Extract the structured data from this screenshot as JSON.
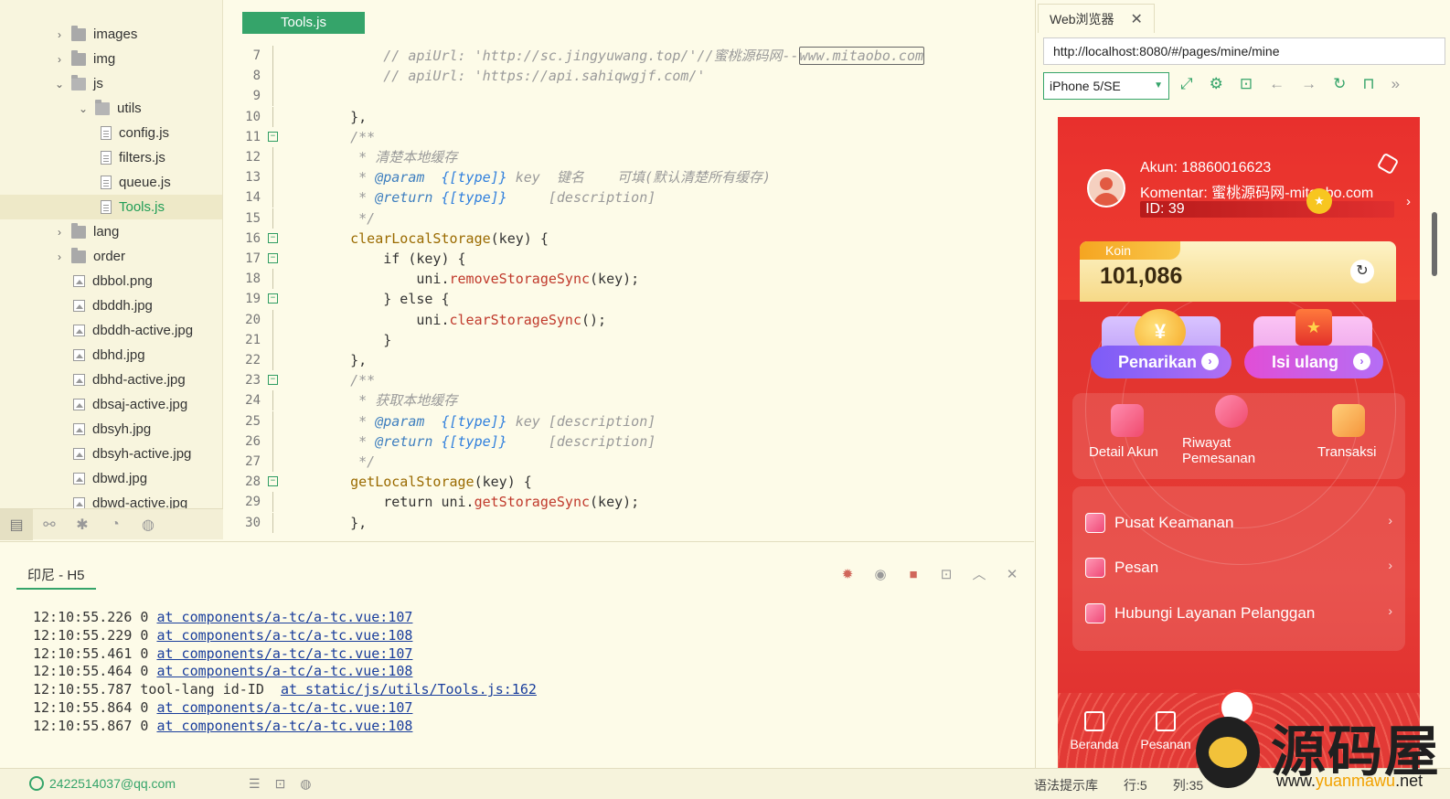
{
  "file_tree": {
    "items": [
      {
        "label": "images",
        "type": "folder",
        "indent": 1,
        "expanded": false
      },
      {
        "label": "img",
        "type": "folder",
        "indent": 1,
        "expanded": false
      },
      {
        "label": "js",
        "type": "folder",
        "indent": 1,
        "expanded": true
      },
      {
        "label": "utils",
        "type": "folder",
        "indent": 2,
        "expanded": true
      },
      {
        "label": "config.js",
        "type": "js",
        "indent": 3
      },
      {
        "label": "filters.js",
        "type": "js",
        "indent": 3
      },
      {
        "label": "queue.js",
        "type": "js",
        "indent": 3
      },
      {
        "label": "Tools.js",
        "type": "js",
        "indent": 3,
        "selected": true
      },
      {
        "label": "lang",
        "type": "folder",
        "indent": 1,
        "expanded": false
      },
      {
        "label": "order",
        "type": "folder",
        "indent": 1,
        "expanded": false
      },
      {
        "label": "dbbol.png",
        "type": "img",
        "indent": 1
      },
      {
        "label": "dbddh.jpg",
        "type": "img",
        "indent": 1
      },
      {
        "label": "dbddh-active.jpg",
        "type": "img",
        "indent": 1
      },
      {
        "label": "dbhd.jpg",
        "type": "img",
        "indent": 1
      },
      {
        "label": "dbhd-active.jpg",
        "type": "img",
        "indent": 1
      },
      {
        "label": "dbsaj-active.jpg",
        "type": "img",
        "indent": 1
      },
      {
        "label": "dbsyh.jpg",
        "type": "img",
        "indent": 1
      },
      {
        "label": "dbsyh-active.jpg",
        "type": "img",
        "indent": 1
      },
      {
        "label": "dbwd.jpg",
        "type": "img",
        "indent": 1
      },
      {
        "label": "dbwd-active.jpg",
        "type": "img",
        "indent": 1
      }
    ]
  },
  "editor": {
    "tab_label": "Tools.js",
    "lines": [
      {
        "n": "7",
        "fold": "",
        "segments": [
          {
            "t": "        "
          },
          {
            "t": "// apiUrl: 'http://sc.jingyuwang.top/'//蜜桃源码网--",
            "c": "tok-comment"
          },
          {
            "t": "www.mitaobo.com",
            "c": "tok-comment boxed"
          }
        ]
      },
      {
        "n": "8",
        "fold": "",
        "segments": [
          {
            "t": "        "
          },
          {
            "t": "// apiUrl: 'https://api.sahiqwgjf.com/'",
            "c": "tok-comment"
          }
        ]
      },
      {
        "n": "9",
        "fold": "",
        "segments": [
          {
            "t": ""
          }
        ]
      },
      {
        "n": "10",
        "fold": "",
        "segments": [
          {
            "t": "    },"
          }
        ]
      },
      {
        "n": "11",
        "fold": "box",
        "segments": [
          {
            "t": "    "
          },
          {
            "t": "/**",
            "c": "tok-comment"
          }
        ]
      },
      {
        "n": "12",
        "fold": "",
        "segments": [
          {
            "t": "     "
          },
          {
            "t": "* 清楚本地缓存",
            "c": "tok-comment"
          }
        ]
      },
      {
        "n": "13",
        "fold": "",
        "segments": [
          {
            "t": "     "
          },
          {
            "t": "* ",
            "c": "tok-comment"
          },
          {
            "t": "@param",
            "c": "tok-tag"
          },
          {
            "t": "  ",
            "c": "tok-comment"
          },
          {
            "t": "{[type]}",
            "c": "tok-type"
          },
          {
            "t": " key  键名    可填(默认清楚所有缓存)",
            "c": "tok-comment"
          }
        ]
      },
      {
        "n": "14",
        "fold": "",
        "segments": [
          {
            "t": "     "
          },
          {
            "t": "* ",
            "c": "tok-comment"
          },
          {
            "t": "@return",
            "c": "tok-tag"
          },
          {
            "t": " ",
            "c": "tok-comment"
          },
          {
            "t": "{[type]}",
            "c": "tok-type"
          },
          {
            "t": "     [description]",
            "c": "tok-comment"
          }
        ]
      },
      {
        "n": "15",
        "fold": "",
        "segments": [
          {
            "t": "     "
          },
          {
            "t": "*/",
            "c": "tok-comment"
          }
        ]
      },
      {
        "n": "16",
        "fold": "box",
        "segments": [
          {
            "t": "    "
          },
          {
            "t": "clearLocalStorage",
            "c": "tok-fn"
          },
          {
            "t": "(key) {"
          }
        ]
      },
      {
        "n": "17",
        "fold": "box",
        "segments": [
          {
            "t": "        if (key) {"
          }
        ]
      },
      {
        "n": "18",
        "fold": "",
        "segments": [
          {
            "t": "            uni."
          },
          {
            "t": "removeStorageSync",
            "c": "tok-method"
          },
          {
            "t": "(key);"
          }
        ]
      },
      {
        "n": "19",
        "fold": "box",
        "segments": [
          {
            "t": "        } else {"
          }
        ]
      },
      {
        "n": "20",
        "fold": "",
        "segments": [
          {
            "t": "            uni."
          },
          {
            "t": "clearStorageSync",
            "c": "tok-method"
          },
          {
            "t": "();"
          }
        ]
      },
      {
        "n": "21",
        "fold": "",
        "segments": [
          {
            "t": "        }"
          }
        ]
      },
      {
        "n": "22",
        "fold": "",
        "segments": [
          {
            "t": "    },"
          }
        ]
      },
      {
        "n": "23",
        "fold": "box",
        "segments": [
          {
            "t": "    "
          },
          {
            "t": "/**",
            "c": "tok-comment"
          }
        ]
      },
      {
        "n": "24",
        "fold": "",
        "segments": [
          {
            "t": "     "
          },
          {
            "t": "* 获取本地缓存",
            "c": "tok-comment"
          }
        ]
      },
      {
        "n": "25",
        "fold": "",
        "segments": [
          {
            "t": "     "
          },
          {
            "t": "* ",
            "c": "tok-comment"
          },
          {
            "t": "@param",
            "c": "tok-tag"
          },
          {
            "t": "  ",
            "c": "tok-comment"
          },
          {
            "t": "{[type]}",
            "c": "tok-type"
          },
          {
            "t": " key [description]",
            "c": "tok-comment"
          }
        ]
      },
      {
        "n": "26",
        "fold": "",
        "segments": [
          {
            "t": "     "
          },
          {
            "t": "* ",
            "c": "tok-comment"
          },
          {
            "t": "@return",
            "c": "tok-tag"
          },
          {
            "t": " ",
            "c": "tok-comment"
          },
          {
            "t": "{[type]}",
            "c": "tok-type"
          },
          {
            "t": "     [description]",
            "c": "tok-comment"
          }
        ]
      },
      {
        "n": "27",
        "fold": "",
        "segments": [
          {
            "t": "     "
          },
          {
            "t": "*/",
            "c": "tok-comment"
          }
        ]
      },
      {
        "n": "28",
        "fold": "box",
        "segments": [
          {
            "t": "    "
          },
          {
            "t": "getLocalStorage",
            "c": "tok-fn"
          },
          {
            "t": "(key) {"
          }
        ]
      },
      {
        "n": "29",
        "fold": "",
        "segments": [
          {
            "t": "        return uni."
          },
          {
            "t": "getStorageSync",
            "c": "tok-method"
          },
          {
            "t": "(key);"
          }
        ]
      },
      {
        "n": "30",
        "fold": "",
        "segments": [
          {
            "t": "    },"
          }
        ]
      }
    ]
  },
  "console": {
    "tab_label": "印尼 - H5",
    "logs": [
      {
        "time": "12:10:55.226",
        "msg": "0",
        "link": "at components/a-tc/a-tc.vue:107"
      },
      {
        "time": "12:10:55.229",
        "msg": "0",
        "link": "at components/a-tc/a-tc.vue:108"
      },
      {
        "time": "12:10:55.461",
        "msg": "0",
        "link": "at components/a-tc/a-tc.vue:107"
      },
      {
        "time": "12:10:55.464",
        "msg": "0",
        "link": "at components/a-tc/a-tc.vue:108"
      },
      {
        "time": "12:10:55.787",
        "msg": "tool-lang id-ID ",
        "link": "at static/js/utils/Tools.js:162"
      },
      {
        "time": "12:10:55.864",
        "msg": "0",
        "link": "at components/a-tc/a-tc.vue:107"
      },
      {
        "time": "12:10:55.867",
        "msg": "0",
        "link": "at components/a-tc/a-tc.vue:108"
      }
    ]
  },
  "statusbar": {
    "user": "2422514037@qq.com",
    "hint": "语法提示库",
    "row": "行:5",
    "col": "列:35"
  },
  "browser": {
    "tab_label": "Web浏览器",
    "close": "✕",
    "url": "http://localhost:8080/#/pages/mine/mine",
    "device": "iPhone 5/SE"
  },
  "phone": {
    "account_line": "Akun: 18860016623",
    "komentar_line": "Komentar: 蜜桃源码网-mitaobo.com",
    "id_line": "ID: 39",
    "koin_label": "Koin",
    "koin_value": "101,086",
    "withdraw_label": "Penarikan",
    "topup_label": "Isi ulang",
    "menu3": [
      "Detail Akun",
      "Riwayat Pemesanan",
      "Transaksi"
    ],
    "menu_list": [
      "Pusat Keamanan",
      "Pesan",
      "Hubungi Layanan Pelanggan"
    ],
    "tabbar": [
      "Beranda",
      "Pesanan"
    ]
  },
  "watermark": {
    "text": "源码屋",
    "url_prefix": "www.",
    "url_hl": "yuanmawu",
    "url_suffix": ".net"
  },
  "colors": {
    "accent": "#35a46a",
    "phone_red": "#e53030",
    "editor_bg": "#fdfbe8"
  }
}
